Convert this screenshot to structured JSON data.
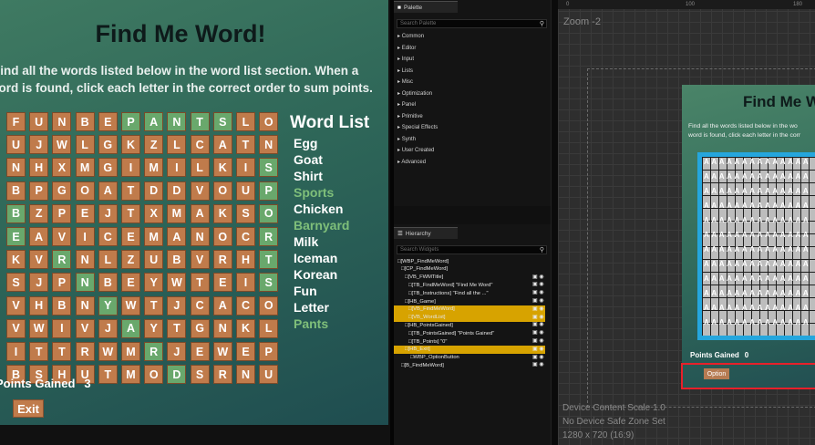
{
  "game": {
    "title": "Find Me Word!",
    "instructions_line1": "Find all the words listed below in the word list section. When a",
    "instructions_line2": "word is found, click each letter in the correct order to sum points.",
    "grid": [
      [
        "F",
        "U",
        "N",
        "B",
        "E",
        "P",
        "A",
        "N",
        "T",
        "S",
        "L",
        "O"
      ],
      [
        "U",
        "J",
        "W",
        "L",
        "G",
        "K",
        "Z",
        "L",
        "C",
        "A",
        "T",
        "N"
      ],
      [
        "N",
        "H",
        "X",
        "M",
        "G",
        "I",
        "M",
        "I",
        "L",
        "K",
        "I",
        "S"
      ],
      [
        "B",
        "P",
        "G",
        "O",
        "A",
        "T",
        "D",
        "D",
        "V",
        "O",
        "U",
        "P"
      ],
      [
        "B",
        "Z",
        "P",
        "E",
        "J",
        "T",
        "X",
        "M",
        "A",
        "K",
        "S",
        "O"
      ],
      [
        "E",
        "A",
        "V",
        "I",
        "C",
        "E",
        "M",
        "A",
        "N",
        "O",
        "C",
        "R"
      ],
      [
        "K",
        "V",
        "R",
        "N",
        "L",
        "Z",
        "U",
        "B",
        "V",
        "R",
        "H",
        "T"
      ],
      [
        "S",
        "J",
        "P",
        "N",
        "B",
        "E",
        "Y",
        "W",
        "T",
        "E",
        "I",
        "S"
      ],
      [
        "V",
        "H",
        "B",
        "N",
        "Y",
        "W",
        "T",
        "J",
        "C",
        "A",
        "C",
        "O"
      ],
      [
        "V",
        "W",
        "I",
        "V",
        "J",
        "A",
        "Y",
        "T",
        "G",
        "N",
        "K",
        "L"
      ],
      [
        "I",
        "T",
        "T",
        "R",
        "W",
        "M",
        "R",
        "J",
        "E",
        "W",
        "E",
        "P"
      ],
      [
        "B",
        "S",
        "H",
        "U",
        "T",
        "M",
        "O",
        "D",
        "S",
        "R",
        "N",
        "U"
      ]
    ],
    "highlighted": [
      [
        0,
        5
      ],
      [
        0,
        6
      ],
      [
        0,
        7
      ],
      [
        0,
        8
      ],
      [
        0,
        9
      ],
      [
        2,
        11
      ],
      [
        3,
        11
      ],
      [
        4,
        11
      ],
      [
        5,
        11
      ],
      [
        6,
        11
      ],
      [
        7,
        11
      ],
      [
        4,
        0
      ],
      [
        5,
        0
      ],
      [
        6,
        2
      ],
      [
        7,
        3
      ],
      [
        8,
        4
      ],
      [
        9,
        5
      ],
      [
        10,
        6
      ],
      [
        11,
        7
      ]
    ],
    "word_list_title": "Word List",
    "words": [
      {
        "text": "Egg",
        "found": false
      },
      {
        "text": "Goat",
        "found": false
      },
      {
        "text": "Shirt",
        "found": false
      },
      {
        "text": "Sports",
        "found": true
      },
      {
        "text": "Chicken",
        "found": false
      },
      {
        "text": "Barnyard",
        "found": true
      },
      {
        "text": "Milk",
        "found": false
      },
      {
        "text": "Iceman",
        "found": false
      },
      {
        "text": "Korean",
        "found": false
      },
      {
        "text": "Fun",
        "found": false
      },
      {
        "text": "Letter",
        "found": false
      },
      {
        "text": "Pants",
        "found": true
      }
    ],
    "points_label": "Points Gained",
    "points_value": "3",
    "exit_label": "Exit",
    "colors": {
      "tile": "#c07b4b",
      "tile_found": "#69a86c",
      "word": "#ffffff",
      "word_found": "#7fbf7a"
    }
  },
  "palette": {
    "tab": "Palette",
    "search_placeholder": "Search Palette",
    "categories": [
      "Common",
      "Editor",
      "Input",
      "Lists",
      "Misc",
      "Optimization",
      "Panel",
      "Primitive",
      "Special Effects",
      "Synth",
      "User Created",
      "Advanced"
    ]
  },
  "hierarchy": {
    "tab": "Hierarchy",
    "search_placeholder": "Search Widgets",
    "items": [
      {
        "text": "[WBP_FindMeWord]",
        "selected": false
      },
      {
        "text": "[CP_FindMeWord]",
        "selected": false
      },
      {
        "text": "[VB_FWMTitle]",
        "selected": false
      },
      {
        "text": "[TB_FindMeWord] \"Find Me Word\"",
        "selected": false
      },
      {
        "text": "[TB_Instructions] \"Find all the ...\"",
        "selected": false
      },
      {
        "text": "[HB_Game]",
        "selected": false
      },
      {
        "text": "[VB_FindMeWord]",
        "selected": true
      },
      {
        "text": "[VB_WordList]",
        "selected": true
      },
      {
        "text": "[HB_PointsGained]",
        "selected": false
      },
      {
        "text": "[TB_PointsGained] \"Points Gained\"",
        "selected": false
      },
      {
        "text": "[TB_Points] \"0\"",
        "selected": false
      },
      {
        "text": "[HB_Exit]",
        "selected": true
      },
      {
        "text": "WBP_OptionButton",
        "selected": false
      },
      {
        "text": "[B_FindMeWord]",
        "selected": false
      }
    ]
  },
  "designer": {
    "zoom": "Zoom -2",
    "ruler_ticks": [
      "0",
      "100",
      "180"
    ],
    "preview_title": "Find Me Wo",
    "preview_instr1": "Find all the words listed below in the wo",
    "preview_instr2": "word is found, click each letter in the corr",
    "preview_letter": "A",
    "preview_points_label": "Points Gained",
    "preview_points_value": "0",
    "preview_option": "Option",
    "scale_line1": "Device Content Scale 1.0",
    "scale_line2": "No Device Safe Zone Set",
    "scale_line3": "1280 x 720 (16:9)"
  }
}
